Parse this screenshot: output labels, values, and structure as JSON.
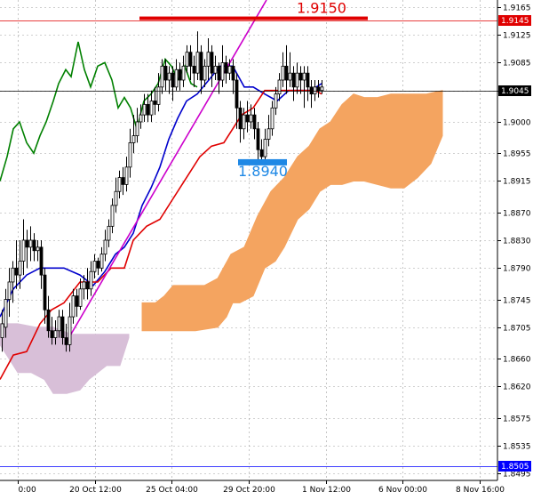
{
  "chart_data": {
    "type": "candlestick",
    "price_ticks": [
      "1.9165",
      "1.9125",
      "1.9085",
      "1.9045",
      "1.9000",
      "1.8955",
      "1.8915",
      "1.8870",
      "1.8830",
      "1.8790",
      "1.8745",
      "1.8705",
      "1.8660",
      "1.8620",
      "1.8575",
      "1.8535",
      "1.8495"
    ],
    "time_labels": [
      "0:00",
      "20 Oct 12:00",
      "25 Oct 04:00",
      "29 Oct 20:00",
      "1 Nov 12:00",
      "6 Nov 00:00",
      "8 Nov 16:00"
    ],
    "price_markers": [
      {
        "label": "1.9145",
        "value": 1.9145,
        "bg": "#e00000",
        "fg": "#ffffff"
      },
      {
        "label": "1.9045",
        "value": 1.9045,
        "bg": "#000000",
        "fg": "#ffffff"
      },
      {
        "label": "1.8505",
        "value": 1.8505,
        "bg": "#0000ff",
        "fg": "#ffffff"
      }
    ],
    "annotations": [
      {
        "label": "1.9150",
        "value": 1.915,
        "color": "#e00000"
      },
      {
        "label": "1.8940",
        "value": 1.894,
        "color": "#1e88e5"
      }
    ],
    "ylim": [
      1.8485,
      1.9175
    ],
    "xlim": [
      0,
      560
    ],
    "series": [
      {
        "color": "#008000",
        "values": [
          [
            0,
            1.8915
          ],
          [
            8,
            1.895
          ],
          [
            15,
            1.899
          ],
          [
            22,
            1.9
          ],
          [
            30,
            1.897
          ],
          [
            38,
            1.8955
          ],
          [
            45,
            1.898
          ],
          [
            52,
            1.9
          ],
          [
            60,
            1.903
          ],
          [
            66,
            1.9055
          ],
          [
            74,
            1.9075
          ],
          [
            80,
            1.9065
          ],
          [
            88,
            1.9115
          ],
          [
            95,
            1.9075
          ],
          [
            102,
            1.905
          ],
          [
            110,
            1.908
          ],
          [
            118,
            1.9085
          ],
          [
            126,
            1.906
          ],
          [
            133,
            1.902
          ],
          [
            140,
            1.9035
          ],
          [
            147,
            1.902
          ],
          [
            154,
            1.899
          ],
          [
            162,
            1.903
          ],
          [
            170,
            1.904
          ],
          [
            178,
            1.9055
          ],
          [
            186,
            1.909
          ],
          [
            193,
            1.908
          ],
          [
            200,
            1.906
          ],
          [
            208,
            1.908
          ],
          [
            215,
            1.9055
          ],
          [
            222,
            1.905
          ]
        ]
      },
      {
        "color": "#0000cc",
        "values": [
          [
            0,
            1.872
          ],
          [
            15,
            1.876
          ],
          [
            30,
            1.878
          ],
          [
            45,
            1.879
          ],
          [
            58,
            1.879
          ],
          [
            72,
            1.879
          ],
          [
            90,
            1.878
          ],
          [
            105,
            1.8765
          ],
          [
            118,
            1.8785
          ],
          [
            130,
            1.881
          ],
          [
            140,
            1.882
          ],
          [
            150,
            1.884
          ],
          [
            160,
            1.888
          ],
          [
            170,
            1.8905
          ],
          [
            180,
            1.8935
          ],
          [
            190,
            1.8975
          ],
          [
            200,
            1.9005
          ],
          [
            210,
            1.903
          ],
          [
            222,
            1.904
          ],
          [
            235,
            1.906
          ],
          [
            248,
            1.908
          ],
          [
            262,
            1.908
          ],
          [
            275,
            1.905
          ],
          [
            285,
            1.905
          ],
          [
            298,
            1.904
          ],
          [
            312,
            1.903
          ],
          [
            325,
            1.9045
          ],
          [
            340,
            1.9045
          ],
          [
            350,
            1.9045
          ],
          [
            362,
            1.9055
          ]
        ]
      },
      {
        "color": "#e00000",
        "values": [
          [
            0,
            1.863
          ],
          [
            15,
            1.8665
          ],
          [
            30,
            1.867
          ],
          [
            45,
            1.871
          ],
          [
            58,
            1.873
          ],
          [
            72,
            1.874
          ],
          [
            90,
            1.877
          ],
          [
            110,
            1.877
          ],
          [
            125,
            1.879
          ],
          [
            140,
            1.879
          ],
          [
            150,
            1.883
          ],
          [
            165,
            1.885
          ],
          [
            180,
            1.886
          ],
          [
            195,
            1.889
          ],
          [
            210,
            1.892
          ],
          [
            225,
            1.895
          ],
          [
            238,
            1.8965
          ],
          [
            252,
            1.897
          ],
          [
            262,
            1.899
          ],
          [
            272,
            1.901
          ],
          [
            285,
            1.902
          ],
          [
            298,
            1.9045
          ],
          [
            310,
            1.9045
          ],
          [
            325,
            1.9045
          ],
          [
            340,
            1.9045
          ],
          [
            355,
            1.9045
          ],
          [
            362,
            1.904
          ]
        ]
      },
      {
        "color": "#cc00cc",
        "values": [
          [
            73,
            1.868
          ],
          [
            300,
            1.9175
          ]
        ]
      }
    ],
    "cloud_bearish": {
      "color": "#d8bfd8",
      "upper": [
        [
          0,
          1.871
        ],
        [
          20,
          1.871
        ],
        [
          40,
          1.8705
        ],
        [
          60,
          1.8705
        ],
        [
          80,
          1.8695
        ],
        [
          100,
          1.8695
        ],
        [
          120,
          1.8695
        ],
        [
          140,
          1.8695
        ],
        [
          145,
          1.8695
        ]
      ],
      "lower": [
        [
          0,
          1.868
        ],
        [
          10,
          1.866
        ],
        [
          20,
          1.864
        ],
        [
          35,
          1.864
        ],
        [
          50,
          1.863
        ],
        [
          60,
          1.861
        ],
        [
          75,
          1.861
        ],
        [
          90,
          1.8615
        ],
        [
          100,
          1.863
        ],
        [
          110,
          1.864
        ],
        [
          120,
          1.865
        ],
        [
          135,
          1.865
        ],
        [
          145,
          1.869
        ]
      ]
    },
    "cloud_bullish": {
      "color": "#f4a460",
      "upper": [
        [
          160,
          1.874
        ],
        [
          175,
          1.874
        ],
        [
          185,
          1.875
        ],
        [
          195,
          1.8765
        ],
        [
          215,
          1.8765
        ],
        [
          230,
          1.8765
        ],
        [
          245,
          1.8775
        ],
        [
          260,
          1.881
        ],
        [
          275,
          1.882
        ],
        [
          290,
          1.8865
        ],
        [
          305,
          1.89
        ],
        [
          320,
          1.892
        ],
        [
          335,
          1.895
        ],
        [
          348,
          1.8965
        ],
        [
          360,
          1.899
        ],
        [
          372,
          1.9
        ],
        [
          385,
          1.9025
        ],
        [
          398,
          1.904
        ],
        [
          410,
          1.9035
        ],
        [
          425,
          1.9035
        ],
        [
          440,
          1.904
        ],
        [
          460,
          1.904
        ],
        [
          480,
          1.904
        ],
        [
          498,
          1.9045
        ]
      ],
      "lower": [
        [
          160,
          1.87
        ],
        [
          175,
          1.87
        ],
        [
          190,
          1.87
        ],
        [
          205,
          1.87
        ],
        [
          220,
          1.87
        ],
        [
          245,
          1.8705
        ],
        [
          255,
          1.872
        ],
        [
          262,
          1.874
        ],
        [
          270,
          1.874
        ],
        [
          285,
          1.875
        ],
        [
          298,
          1.879
        ],
        [
          310,
          1.88
        ],
        [
          320,
          1.882
        ],
        [
          335,
          1.886
        ],
        [
          348,
          1.8875
        ],
        [
          360,
          1.89
        ],
        [
          372,
          1.891
        ],
        [
          385,
          1.891
        ],
        [
          398,
          1.8915
        ],
        [
          410,
          1.8915
        ],
        [
          425,
          1.891
        ],
        [
          440,
          1.8905
        ],
        [
          455,
          1.8905
        ],
        [
          470,
          1.892
        ],
        [
          485,
          1.894
        ],
        [
          498,
          1.898
        ]
      ]
    },
    "candles": [
      [
        2,
        1.869,
        1.871,
        1.867,
        1.873
      ],
      [
        6,
        1.8705,
        1.8745,
        1.869,
        1.876
      ],
      [
        10,
        1.8745,
        1.877,
        1.872,
        1.879
      ],
      [
        14,
        1.877,
        1.879,
        1.874,
        1.88
      ],
      [
        18,
        1.879,
        1.878,
        1.876,
        1.883
      ],
      [
        22,
        1.878,
        1.88,
        1.876,
        1.883
      ],
      [
        26,
        1.88,
        1.883,
        1.878,
        1.886
      ],
      [
        30,
        1.883,
        1.882,
        1.879,
        1.8845
      ],
      [
        34,
        1.882,
        1.883,
        1.88,
        1.885
      ],
      [
        38,
        1.883,
        1.8815,
        1.88,
        1.884
      ],
      [
        42,
        1.8815,
        1.882,
        1.88,
        1.883
      ],
      [
        46,
        1.882,
        1.878,
        1.876,
        1.883
      ],
      [
        50,
        1.878,
        1.873,
        1.871,
        1.879
      ],
      [
        54,
        1.873,
        1.87,
        1.869,
        1.875
      ],
      [
        58,
        1.87,
        1.869,
        1.868,
        1.872
      ],
      [
        62,
        1.869,
        1.87,
        1.868,
        1.8715
      ],
      [
        66,
        1.87,
        1.872,
        1.869,
        1.873
      ],
      [
        70,
        1.872,
        1.869,
        1.868,
        1.873
      ],
      [
        74,
        1.869,
        1.868,
        1.867,
        1.871
      ],
      [
        78,
        1.868,
        1.872,
        1.867,
        1.874
      ],
      [
        82,
        1.872,
        1.875,
        1.871,
        1.876
      ],
      [
        86,
        1.875,
        1.8735,
        1.872,
        1.876
      ],
      [
        90,
        1.8735,
        1.876,
        1.873,
        1.8775
      ],
      [
        94,
        1.876,
        1.877,
        1.8745,
        1.878
      ],
      [
        98,
        1.877,
        1.876,
        1.8745,
        1.879
      ],
      [
        102,
        1.876,
        1.8785,
        1.875,
        1.88
      ],
      [
        106,
        1.8785,
        1.88,
        1.8775,
        1.881
      ],
      [
        110,
        1.88,
        1.879,
        1.878,
        1.8805
      ],
      [
        114,
        1.879,
        1.881,
        1.8785,
        1.882
      ],
      [
        118,
        1.881,
        1.883,
        1.88,
        1.8845
      ],
      [
        122,
        1.883,
        1.885,
        1.882,
        1.886
      ],
      [
        126,
        1.885,
        1.888,
        1.884,
        1.889
      ],
      [
        130,
        1.888,
        1.89,
        1.887,
        1.892
      ],
      [
        134,
        1.89,
        1.892,
        1.889,
        1.893
      ],
      [
        138,
        1.892,
        1.891,
        1.8895,
        1.8935
      ],
      [
        142,
        1.891,
        1.8935,
        1.89,
        1.895
      ],
      [
        146,
        1.8935,
        1.897,
        1.892,
        1.899
      ],
      [
        150,
        1.897,
        1.898,
        1.8955,
        1.901
      ],
      [
        154,
        1.898,
        1.9,
        1.897,
        1.902
      ],
      [
        158,
        1.9,
        1.901,
        1.899,
        1.9025
      ],
      [
        162,
        1.901,
        1.9025,
        1.9,
        1.904
      ],
      [
        166,
        1.9025,
        1.901,
        1.9,
        1.904
      ],
      [
        170,
        1.901,
        1.903,
        1.9,
        1.9045
      ],
      [
        174,
        1.903,
        1.9025,
        1.901,
        1.905
      ],
      [
        178,
        1.9025,
        1.905,
        1.9015,
        1.907
      ],
      [
        182,
        1.905,
        1.908,
        1.904,
        1.909
      ],
      [
        186,
        1.908,
        1.906,
        1.9045,
        1.909
      ],
      [
        190,
        1.906,
        1.907,
        1.904,
        1.908
      ],
      [
        194,
        1.907,
        1.905,
        1.903,
        1.908
      ],
      [
        198,
        1.905,
        1.9075,
        1.9045,
        1.909
      ],
      [
        202,
        1.9075,
        1.906,
        1.9045,
        1.9085
      ],
      [
        206,
        1.906,
        1.908,
        1.905,
        1.9095
      ],
      [
        210,
        1.908,
        1.91,
        1.907,
        1.911
      ],
      [
        214,
        1.91,
        1.908,
        1.906,
        1.911
      ],
      [
        218,
        1.908,
        1.907,
        1.905,
        1.9095
      ],
      [
        222,
        1.907,
        1.91,
        1.906,
        1.913
      ],
      [
        226,
        1.91,
        1.906,
        1.904,
        1.911
      ],
      [
        230,
        1.906,
        1.908,
        1.905,
        1.909
      ],
      [
        234,
        1.908,
        1.91,
        1.906,
        1.912
      ],
      [
        238,
        1.91,
        1.907,
        1.905,
        1.911
      ],
      [
        242,
        1.907,
        1.908,
        1.906,
        1.9095
      ],
      [
        246,
        1.908,
        1.906,
        1.904,
        1.9085
      ],
      [
        250,
        1.906,
        1.9085,
        1.905,
        1.911
      ],
      [
        254,
        1.9085,
        1.907,
        1.9055,
        1.9095
      ],
      [
        258,
        1.907,
        1.908,
        1.906,
        1.909
      ],
      [
        262,
        1.908,
        1.906,
        1.904,
        1.909
      ],
      [
        266,
        1.906,
        1.902,
        1.899,
        1.907
      ],
      [
        270,
        1.902,
        1.899,
        1.897,
        1.903
      ],
      [
        274,
        1.899,
        1.901,
        1.8975,
        1.902
      ],
      [
        278,
        1.901,
        1.9,
        1.8985,
        1.903
      ],
      [
        282,
        1.9,
        1.901,
        1.899,
        1.9025
      ],
      [
        286,
        1.901,
        1.899,
        1.8975,
        1.902
      ],
      [
        290,
        1.899,
        1.896,
        1.894,
        1.9
      ],
      [
        294,
        1.896,
        1.895,
        1.894,
        1.8975
      ],
      [
        298,
        1.895,
        1.8975,
        1.8945,
        1.899
      ],
      [
        302,
        1.8975,
        1.899,
        1.8965,
        1.901
      ],
      [
        306,
        1.899,
        1.902,
        1.898,
        1.903
      ],
      [
        310,
        1.902,
        1.904,
        1.901,
        1.905
      ],
      [
        314,
        1.904,
        1.906,
        1.903,
        1.907
      ],
      [
        318,
        1.906,
        1.908,
        1.905,
        1.91
      ],
      [
        322,
        1.908,
        1.906,
        1.904,
        1.911
      ],
      [
        326,
        1.906,
        1.907,
        1.905,
        1.91
      ],
      [
        330,
        1.907,
        1.905,
        1.903,
        1.908
      ],
      [
        334,
        1.905,
        1.907,
        1.904,
        1.9085
      ],
      [
        338,
        1.907,
        1.906,
        1.904,
        1.908
      ],
      [
        342,
        1.906,
        1.907,
        1.902,
        1.908
      ],
      [
        346,
        1.907,
        1.905,
        1.903,
        1.908
      ],
      [
        350,
        1.905,
        1.904,
        1.902,
        1.906
      ],
      [
        354,
        1.904,
        1.905,
        1.903,
        1.906
      ],
      [
        358,
        1.905,
        1.9045,
        1.9035,
        1.906
      ],
      [
        362,
        1.9045,
        1.905,
        1.904,
        1.906
      ]
    ]
  }
}
